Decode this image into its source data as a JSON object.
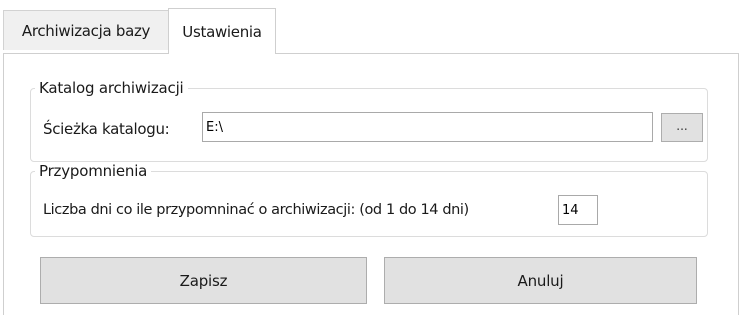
{
  "tabs": [
    {
      "label": "Archiwizacja bazy",
      "active": false
    },
    {
      "label": "Ustawienia",
      "active": true
    }
  ],
  "archive_group": {
    "legend": "Katalog archiwizacji",
    "path_label": "Ścieżka katalogu:",
    "path_value": "E:\\",
    "browse_label": "..."
  },
  "reminder_group": {
    "legend": "Przypomnienia",
    "days_label": "Liczba dni co ile przypomninać o archiwizacji: (od 1 do 14 dni)",
    "days_value": "14"
  },
  "buttons": {
    "save_label": "Zapisz",
    "cancel_label": "Anuluj"
  },
  "colors": {
    "window_bg": "#ffffff",
    "tab_inactive_bg": "#f0f0f0",
    "button_bg": "#e1e1e1",
    "button_border": "#adadad",
    "group_border": "#dcdcdc"
  }
}
